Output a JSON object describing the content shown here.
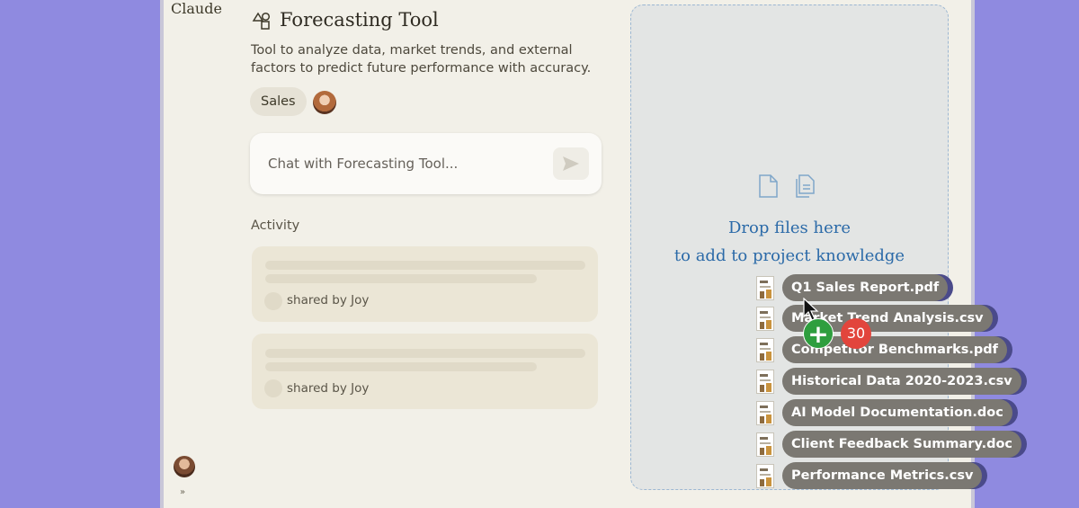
{
  "app": {
    "brand": "Claude"
  },
  "project": {
    "title": "Forecasting Tool",
    "description": "Tool to analyze data, market trends, and external factors to predict future performance with accuracy.",
    "tag": "Sales"
  },
  "chat": {
    "placeholder": "Chat with Forecasting Tool..."
  },
  "activity": {
    "label": "Activity",
    "items": [
      {
        "shared_by": "shared by Joy"
      },
      {
        "shared_by": "shared by Joy"
      }
    ]
  },
  "drop_zone": {
    "line1": "Drop files here",
    "line2": "to add to project knowledge"
  },
  "drag": {
    "count": "30",
    "files": [
      "Q1 Sales Report.pdf",
      "Market Trend Analysis.csv",
      "Competitor Benchmarks.pdf",
      "Historical Data 2020-2023.csv",
      "AI Model Documentation.doc",
      "Client Feedback Summary.doc",
      "Performance Metrics.csv"
    ]
  },
  "colors": {
    "background": "#8f8ae0",
    "drop_text": "#2b6aa8",
    "plus_badge": "#2e9e3e",
    "count_badge": "#e2453c"
  }
}
